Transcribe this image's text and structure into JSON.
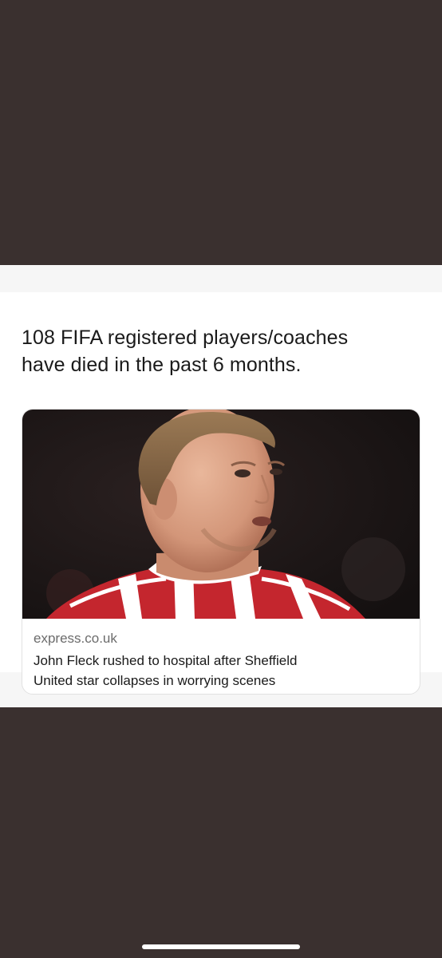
{
  "tweet": {
    "text_line1": "108 FIFA registered players/coaches",
    "text_line2": "have died in the past 6 months."
  },
  "link_card": {
    "domain": "express.co.uk",
    "title_line1": "John Fleck rushed to hospital after Sheffield",
    "title_line2": "United star collapses in worrying scenes",
    "image_subject": "photo-footballer"
  },
  "colors": {
    "background": "#3a302f",
    "post_background": "#ffffff",
    "text": "#1a1a1a",
    "muted_text": "#6b6b6b",
    "jersey_red": "#c4262e"
  }
}
